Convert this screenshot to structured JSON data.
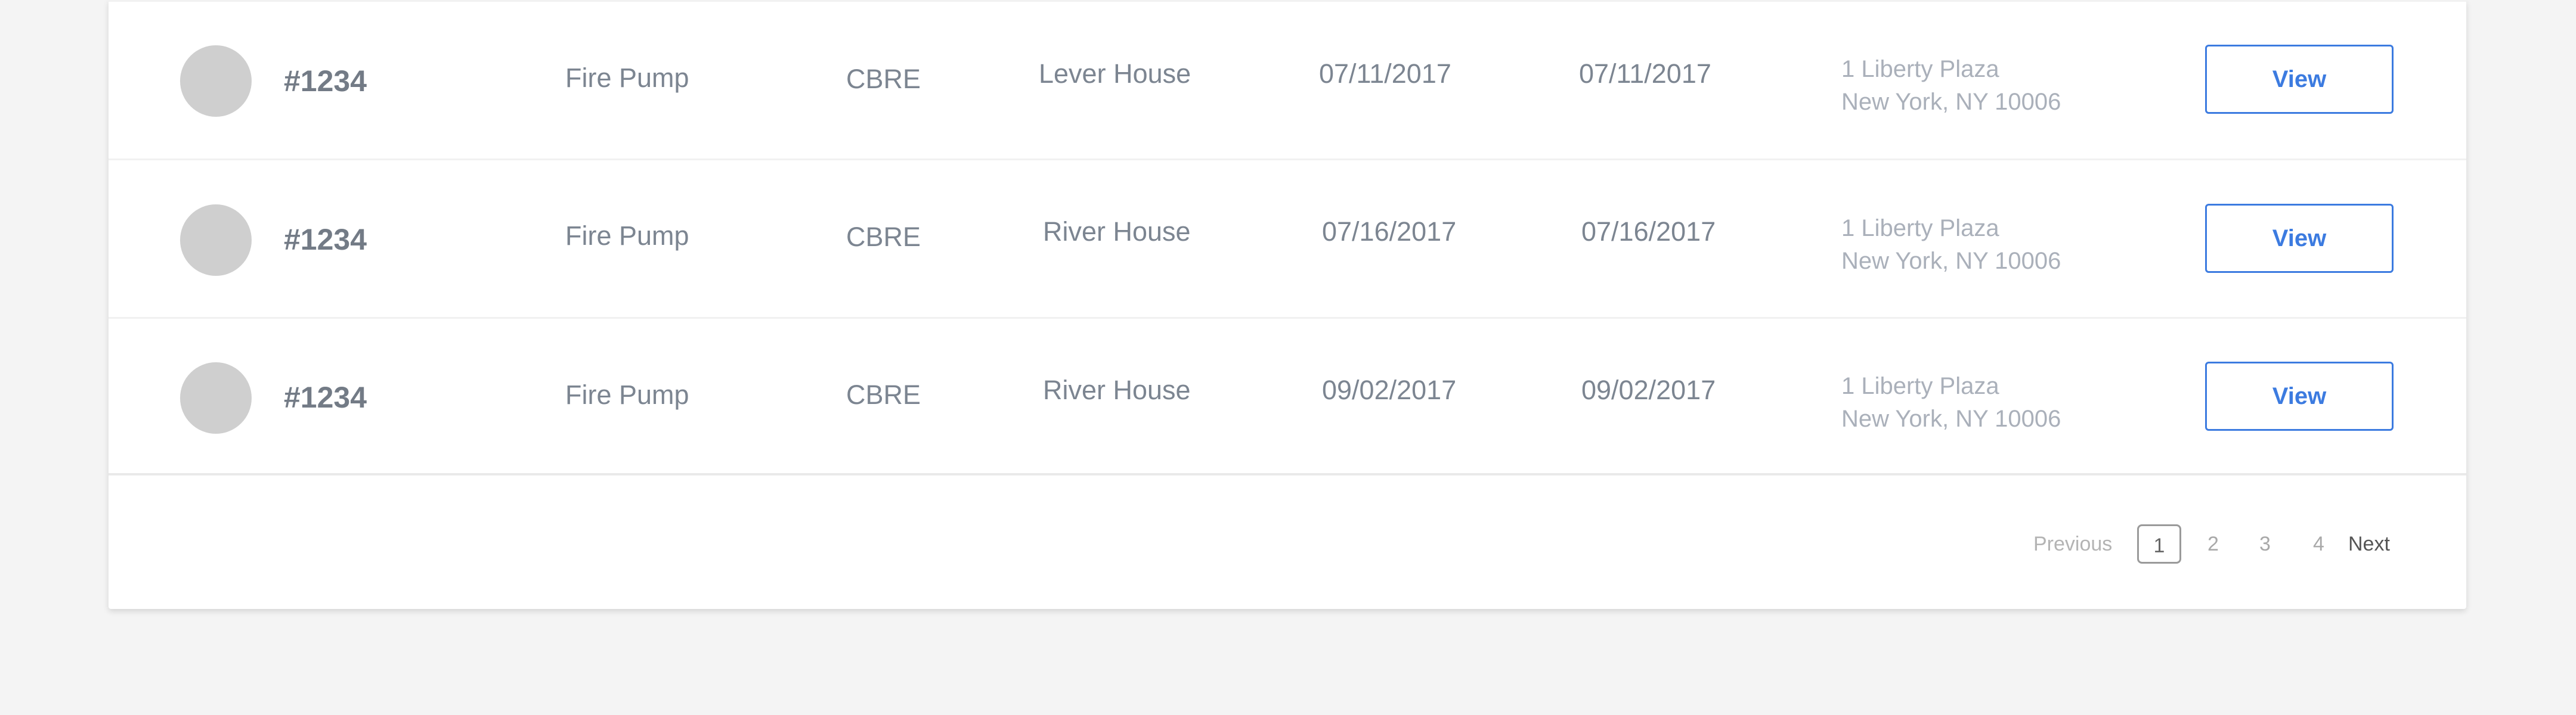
{
  "table": {
    "rows": [
      {
        "id": "#1234",
        "equipment": "Fire Pump",
        "company": "CBRE",
        "building": "Lever House",
        "date_1": "07/11/2017",
        "date_2": "07/11/2017",
        "address_line1": "1 Liberty Plaza",
        "address_line2": "New York, NY 10006",
        "action_label": "View"
      },
      {
        "id": "#1234",
        "equipment": "Fire Pump",
        "company": "CBRE",
        "building": "River House",
        "date_1": "07/16/2017",
        "date_2": "07/16/2017",
        "address_line1": "1 Liberty Plaza",
        "address_line2": "New York, NY 10006",
        "action_label": "View"
      },
      {
        "id": "#1234",
        "equipment": "Fire Pump",
        "company": "CBRE",
        "building": "River House",
        "date_1": "09/02/2017",
        "date_2": "09/02/2017",
        "address_line1": "1 Liberty Plaza",
        "address_line2": "New York, NY 10006",
        "action_label": "View"
      }
    ]
  },
  "pagination": {
    "previous_label": "Previous",
    "pages": [
      "1",
      "2",
      "3",
      "4"
    ],
    "current_page": "1",
    "next_label": "Next"
  },
  "colors": {
    "accent": "#3c7be0",
    "avatar_placeholder": "#cfcfcf",
    "background": "#f4f4f4"
  }
}
